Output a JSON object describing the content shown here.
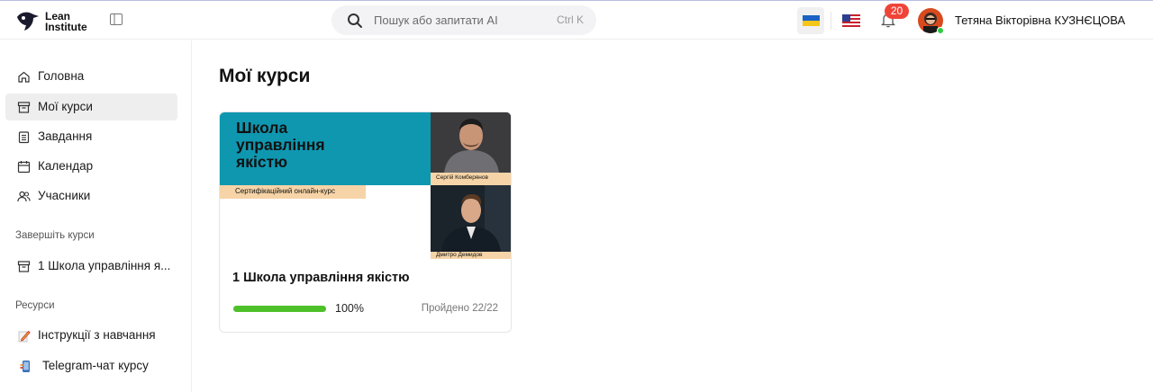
{
  "header": {
    "logo_line1": "Lean",
    "logo_line2": "Institute",
    "search_placeholder": "Пошук або запитати AI",
    "search_shortcut": "Ctrl K",
    "notifications_count": "20",
    "user_name": "Тетяна Вікторівна КУЗНЄЦОВА",
    "languages": [
      "uk-flag-icon",
      "us-flag-icon"
    ]
  },
  "sidebar": {
    "items": [
      {
        "label": "Головна",
        "icon": "home-icon"
      },
      {
        "label": "Мої курси",
        "icon": "archive-icon",
        "active": true
      },
      {
        "label": "Завдання",
        "icon": "clipboard-icon"
      },
      {
        "label": "Календар",
        "icon": "calendar-icon"
      },
      {
        "label": "Учасники",
        "icon": "users-icon"
      }
    ],
    "finish_section": "Завершіть курси",
    "finish_items": [
      {
        "label": "1 Школа управління я...",
        "icon": "archive-icon"
      }
    ],
    "resources_section": "Ресурси",
    "resources_items": [
      {
        "label": "Інструкції з навчання",
        "icon": "pencil-note-icon"
      },
      {
        "label": "Telegram-чат курсу",
        "icon": "phone-icon"
      }
    ]
  },
  "main": {
    "title": "Мої курси",
    "courses": [
      {
        "banner_title": "Школа управління якістю",
        "banner_tag": "Сертифікаційний онлайн-курс",
        "speaker1": "Сергій Комберянов",
        "speaker2": "Дмитро Демидов",
        "title": "1 Школа управління якістю",
        "progress_percent": 100,
        "progress_label": "100%",
        "completed_label": "Пройдено 22/22"
      }
    ]
  },
  "colors": {
    "accent_teal": "#0f97b0",
    "progress_green": "#4ec12a",
    "badge_red": "#f04438",
    "banner_tag": "#f6d4a7"
  }
}
